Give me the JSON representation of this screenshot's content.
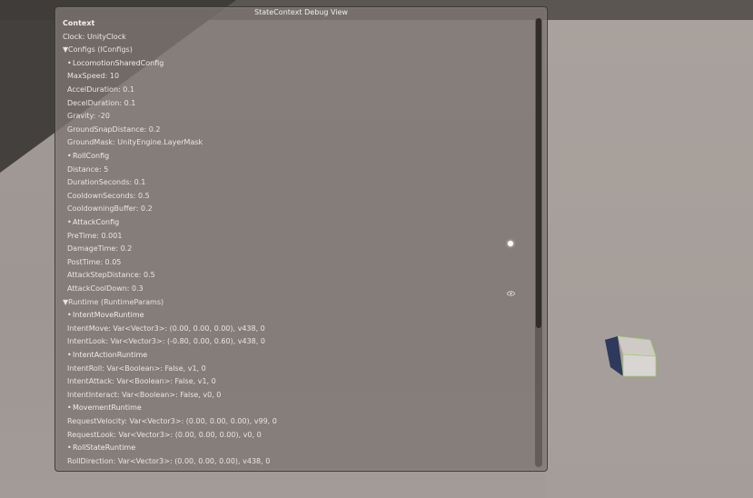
{
  "window": {
    "title": "StateContext Debug View"
  },
  "rows": [
    {
      "kind": "header",
      "text": "Context"
    },
    {
      "kind": "plain",
      "text": "Clock: UnityClock"
    },
    {
      "kind": "section",
      "marker": "▼",
      "text": "Configs (IConfigs)"
    },
    {
      "kind": "item",
      "marker": "•",
      "text": "LocomotionSharedConfig"
    },
    {
      "kind": "field",
      "text": "MaxSpeed: 10"
    },
    {
      "kind": "field",
      "text": "AccelDuration: 0.1"
    },
    {
      "kind": "field",
      "text": "DecelDuration: 0.1"
    },
    {
      "kind": "field",
      "text": "Gravity: -20"
    },
    {
      "kind": "field",
      "text": "GroundSnapDistance: 0.2"
    },
    {
      "kind": "field",
      "text": "GroundMask: UnityEngine.LayerMask"
    },
    {
      "kind": "item",
      "marker": "•",
      "text": "RollConfig"
    },
    {
      "kind": "field",
      "text": "Distance: 5"
    },
    {
      "kind": "field",
      "text": "DurationSeconds: 0.1"
    },
    {
      "kind": "field",
      "text": "CooldownSeconds: 0.5"
    },
    {
      "kind": "field",
      "text": "CooldowningBuffer: 0.2"
    },
    {
      "kind": "item",
      "marker": "•",
      "text": "AttackConfig"
    },
    {
      "kind": "field",
      "text": "PreTime: 0.001"
    },
    {
      "kind": "field",
      "text": "DamageTime: 0.2"
    },
    {
      "kind": "field",
      "text": "PostTime: 0.05"
    },
    {
      "kind": "field",
      "text": "AttackStepDistance: 0.5"
    },
    {
      "kind": "field",
      "text": "AttackCoolDown: 0.3"
    },
    {
      "kind": "section",
      "marker": "▼",
      "text": "Runtime (RuntimeParams)"
    },
    {
      "kind": "item",
      "marker": "•",
      "text": "IntentMoveRuntime"
    },
    {
      "kind": "field",
      "text": "IntentMove: Var<Vector3>: (0.00, 0.00, 0.00), v438, 0"
    },
    {
      "kind": "field",
      "text": "IntentLook: Var<Vector3>: (-0.80, 0.00, 0.60), v438, 0"
    },
    {
      "kind": "item",
      "marker": "•",
      "text": "IntentActionRuntime"
    },
    {
      "kind": "field",
      "text": "IntentRoll: Var<Boolean>: False, v1, 0"
    },
    {
      "kind": "field",
      "text": "IntentAttack: Var<Boolean>: False, v1, 0"
    },
    {
      "kind": "field",
      "text": "IntentInteract: Var<Boolean>: False, v0, 0"
    },
    {
      "kind": "item",
      "marker": "•",
      "text": "MovementRuntime"
    },
    {
      "kind": "field",
      "text": "RequestVelocity: Var<Vector3>: (0.00, 0.00, 0.00), v99, 0"
    },
    {
      "kind": "field",
      "text": "RequestLook: Var<Vector3>: (0.00, 0.00, 0.00), v0, 0"
    },
    {
      "kind": "item",
      "marker": "•",
      "text": "RollStateRuntime"
    },
    {
      "kind": "field",
      "text": "RollDirection: Var<Vector3>: (0.00, 0.00, 0.00), v438, 0"
    }
  ],
  "scroll": {
    "position": 0.0,
    "visible_fraction": 0.69
  },
  "colors": {
    "panel_bg": "#7d7672",
    "text": "#ecebea",
    "scroll_thumb": "#2f2c2a",
    "scene_ground": "#9e9692",
    "cube_front": "#d9d5d2",
    "cube_side": "#2d3a5c"
  },
  "icons": {
    "glint": "light-glint-icon",
    "eye": "eye-icon"
  }
}
